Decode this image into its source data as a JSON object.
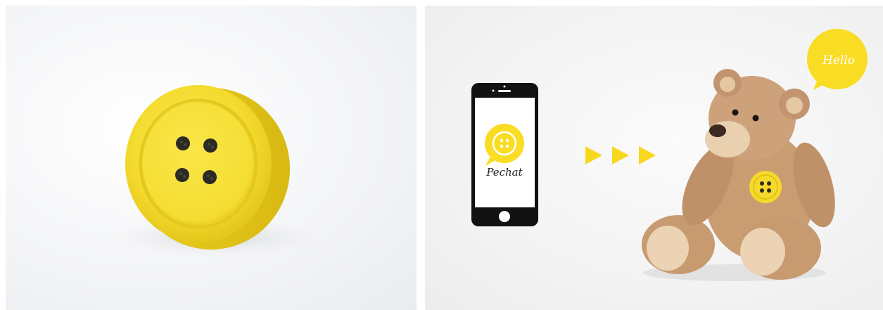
{
  "panels": {
    "left": {
      "subject": "yellow-button-device"
    },
    "right": {
      "subject": "phone-to-bear-illustration"
    }
  },
  "phone": {
    "app_name": "Pechat"
  },
  "speech_bubble": {
    "text": "Hello"
  },
  "colors": {
    "accent_yellow": "#f9dd24",
    "button_yellow": "#f6e03a",
    "phone_black": "#111111",
    "bear_tan": "#c9a07a",
    "arrow_yellow": "#f8d81e"
  },
  "icons": [
    "play-arrow-icon",
    "play-arrow-icon",
    "play-arrow-icon"
  ]
}
